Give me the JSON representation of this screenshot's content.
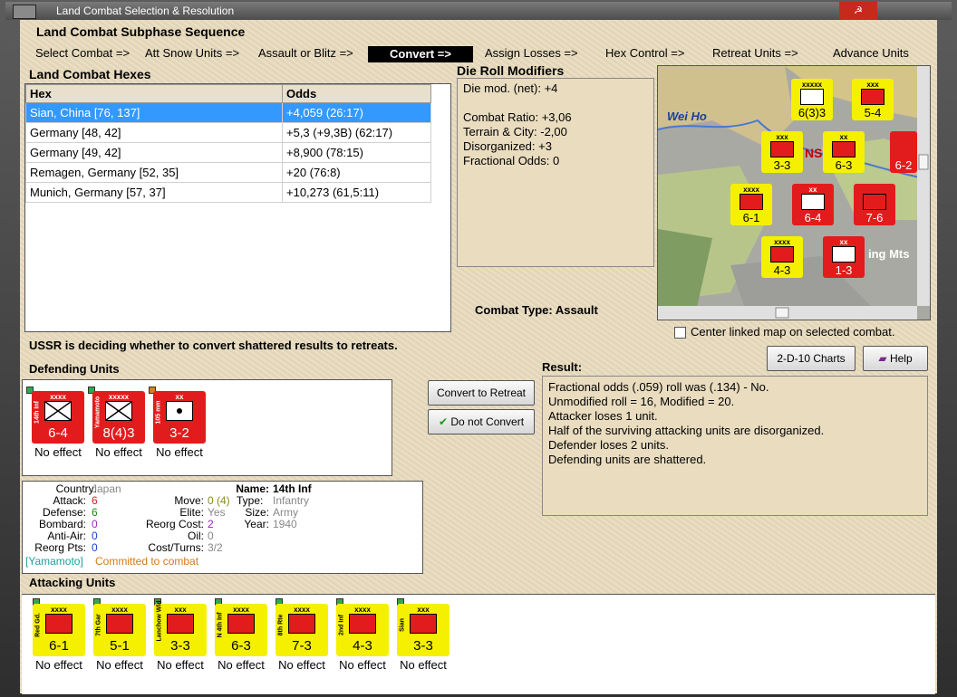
{
  "window": {
    "title": "Land Combat Selection & Resolution"
  },
  "subphase": {
    "heading": "Land Combat Subphase Sequence",
    "steps": [
      "Select Combat =>",
      "Att Snow Units =>",
      "Assault or Blitz =>",
      "Convert =>",
      "Assign Losses =>",
      "Hex Control =>",
      "Retreat Units =>",
      "Advance Units"
    ],
    "active_index": 3
  },
  "hexes": {
    "heading": "Land Combat Hexes",
    "columns": [
      "Hex",
      "Odds"
    ],
    "rows": [
      {
        "hex": "Sian, China [76, 137]",
        "odds": "+4,059 (26:17)"
      },
      {
        "hex": "Germany [48, 42]",
        "odds": "+5,3 (+9,3B) (62:17)"
      },
      {
        "hex": "Germany [49, 42]",
        "odds": "+8,900 (78:15)"
      },
      {
        "hex": "Remagen, Germany [52, 35]",
        "odds": "+20 (76:8)"
      },
      {
        "hex": "Munich, Germany [57, 37]",
        "odds": "+10,273 (61,5:11)"
      }
    ],
    "selected_index": 0
  },
  "modifiers": {
    "heading": "Die Roll Modifiers",
    "lines": [
      "Die mod. (net): +4",
      "",
      "Combat Ratio: +3,06",
      "Terrain & City: -2,00",
      "Disorganized: +3",
      "Fractional Odds: 0"
    ]
  },
  "combat_type": {
    "label": "Combat Type:",
    "value": "Assault"
  },
  "map": {
    "labels": [
      "Wei Ho",
      "ing Mts",
      "NS"
    ],
    "counters": [
      {
        "size": "xxxxx",
        "str": "6(3)3",
        "color": "yellow"
      },
      {
        "size": "xxx",
        "str": "5-4",
        "color": "yellow"
      },
      {
        "size": "xxx",
        "str": "3-3",
        "color": "yellow"
      },
      {
        "size": "xx",
        "str": "6-3",
        "color": "yellow"
      },
      {
        "size": "xxxx",
        "str": "6-1",
        "color": "yellow"
      },
      {
        "size": "xx",
        "str": "6-4",
        "color": "red"
      },
      {
        "size": "",
        "str": "7-6",
        "color": "red"
      },
      {
        "size": "xxxx",
        "str": "4-3",
        "color": "yellow"
      },
      {
        "size": "xx",
        "str": "1-3",
        "color": "red"
      },
      {
        "size": "",
        "str": "6-2",
        "color": "red"
      }
    ]
  },
  "center_map": {
    "label": "Center linked map on selected combat.",
    "checked": false
  },
  "status": "USSR is deciding whether to convert shattered results to retreats.",
  "buttons": {
    "charts": "2-D-10 Charts",
    "help": "Help",
    "convert": "Convert to Retreat",
    "not_convert": "Do not Convert"
  },
  "defending": {
    "heading": "Defending Units",
    "units": [
      {
        "size": "xxxx",
        "name": "14th Inf",
        "str": "6-4",
        "effect": "No effect"
      },
      {
        "size": "xxxxx",
        "name": "Yamamoto",
        "str": "8(4)3",
        "effect": "No effect"
      },
      {
        "size": "xx",
        "name": "105 mm",
        "str": "3-2",
        "effect": "No effect"
      }
    ]
  },
  "result": {
    "heading": "Result:",
    "lines": [
      "Fractional odds (.059) roll was (.134)  - No.",
      "Unmodified roll = 16, Modified = 20.",
      "Attacker loses 1 unit.",
      "Half of the surviving attacking units are disorganized.",
      "Defender loses 2 units.",
      "Defending units are shattered."
    ]
  },
  "unit_info": {
    "country_label": "Country:",
    "country": "Japan",
    "attack_label": "Attack:",
    "attack": "6",
    "defense_label": "Defense:",
    "defense": "6",
    "bombard_label": "Bombard:",
    "bombard": "0",
    "antiair_label": "Anti-Air:",
    "antiair": "0",
    "reorg_label": "Reorg Pts:",
    "reorg": "0",
    "name_label": "Name:",
    "name": "14th Inf",
    "move_label": "Move:",
    "move": "0 (4)",
    "type_label": "Type:",
    "type": "Infantry",
    "elite_label": "Elite:",
    "elite": "Yes",
    "size_label": "Size:",
    "size": "Army",
    "reorgcost_label": "Reorg Cost:",
    "reorgcost": "2",
    "year_label": "Year:",
    "year": "1940",
    "oil_label": "Oil:",
    "oil": "0",
    "costturns_label": "Cost/Turns:",
    "costturns": "3/2",
    "commander": "[Yamamoto]",
    "committed": "Committed to combat"
  },
  "attacking": {
    "heading": "Attacking Units",
    "units": [
      {
        "size": "xxxx",
        "name": "Red Gd.",
        "str": "6-1",
        "effect": "No effect"
      },
      {
        "size": "xxxx",
        "name": "7th Gar",
        "str": "5-1",
        "effect": "No effect"
      },
      {
        "size": "xxx",
        "name": "Lanchow Wld",
        "str": "3-3",
        "effect": "No effect"
      },
      {
        "size": "xxxx",
        "name": "N 4th Inf",
        "str": "6-3",
        "effect": "No effect"
      },
      {
        "size": "xxxx",
        "name": "8th Rte",
        "str": "7-3",
        "effect": "No effect"
      },
      {
        "size": "xxxx",
        "name": "2nd Inf",
        "str": "4-3",
        "effect": "No effect"
      },
      {
        "size": "xxx",
        "name": "Sian",
        "str": "3-3",
        "effect": "No effect"
      }
    ]
  },
  "colors": {
    "selected": "#3399ff",
    "active_step": "#000000",
    "red_unit": "#e21c1c",
    "yellow_unit": "#f5f000"
  }
}
